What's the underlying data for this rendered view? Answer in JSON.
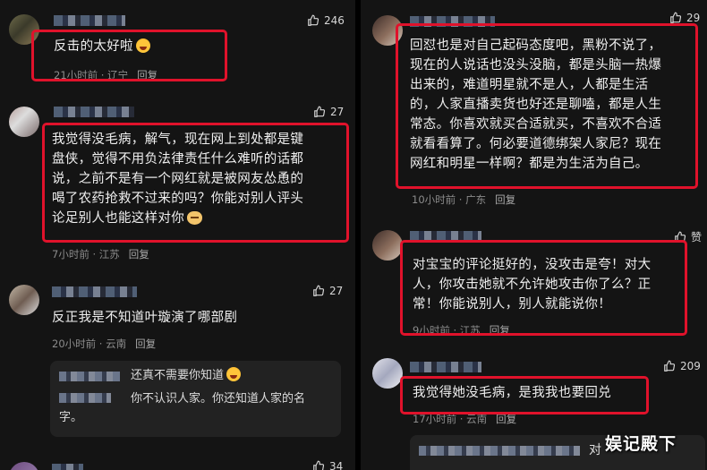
{
  "left": {
    "comments": [
      {
        "likes": "246",
        "text_lines": [
          "反击的太好啦"
        ],
        "time": "21小时前",
        "location": "辽宁",
        "reply": "回复"
      },
      {
        "likes": "27",
        "text_lines": [
          "我觉得没毛病，解气，现在网上到处都是键",
          "盘侠，觉得不用负法律责任什么难听的话都",
          "说，之前不是有一个网红就是被网友怂恿的",
          "喝了农药抢救不过来的吗？你能对别人评头",
          "论足别人也能这样对你"
        ],
        "time": "7小时前",
        "location": "江苏",
        "reply": "回复"
      },
      {
        "likes": "27",
        "text_lines": [
          "反正我是不知道叶璇演了哪部剧"
        ],
        "time": "20小时前",
        "location": "云南",
        "reply": "回复"
      }
    ],
    "sub_replies": [
      {
        "text": "还真不需要你知道"
      },
      {
        "text_lines": [
          "你不认识人家。你还知道人家的名",
          "字。"
        ]
      }
    ],
    "bottom_partial_likes": "34"
  },
  "right": {
    "comments": [
      {
        "likes": "29",
        "text_lines": [
          "回怼也是对自己起码态度吧，黑粉不说了，",
          "现在的人说话也没头没脑，都是头脑一热爆",
          "出来的，难道明星就不是人，人都是生活",
          "的，人家直播卖货也好还是聊嗑，都是人生",
          "常态。你喜欢就买合适就买，不喜欢不合适",
          "就看看算了。何必要道德绑架人家尼？现在",
          "网红和明星一样啊？都是为生活为自己。"
        ],
        "time": "10小时前",
        "location": "广东",
        "reply": "回复"
      },
      {
        "likes": "赞",
        "text_lines": [
          "对宝宝的评论挺好的，没攻击是夸！对大",
          "人，你攻击她就不允许她攻击你了么？正",
          "常！你能说别人，别人就能说你！"
        ],
        "time": "9小时前",
        "location": "江苏",
        "reply": "回复"
      },
      {
        "likes": "209",
        "text_lines": [
          "我觉得她没毛病，是我我也要回兑"
        ],
        "time": "17小时前",
        "location": "云南",
        "reply": "回复"
      }
    ],
    "bottom_partial_text": "对"
  },
  "watermark": "娱记殿下",
  "colors": {
    "highlight": "#e0122b",
    "background": "#141414",
    "meta": "#8c8c8c"
  }
}
